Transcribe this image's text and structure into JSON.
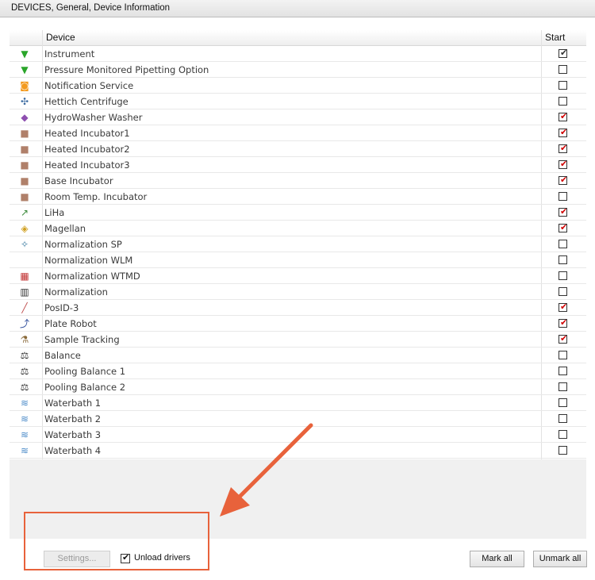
{
  "header": {
    "title": "DEVICES, General, Device Information"
  },
  "table": {
    "col_device": "Device",
    "col_start": "Start",
    "rows": [
      {
        "name": "Instrument",
        "icon": "green-triangle-icon",
        "glyph": "▼",
        "color": "#2aa52a",
        "checked": "gray"
      },
      {
        "name": "Pressure Monitored Pipetting Option",
        "icon": "green-triangle-icon",
        "glyph": "▼",
        "color": "#2aa52a",
        "checked": "off"
      },
      {
        "name": "Notification Service",
        "icon": "rss-icon",
        "glyph": "◙",
        "color": "#f39a1f",
        "checked": "off"
      },
      {
        "name": "Hettich Centrifuge",
        "icon": "centrifuge-icon",
        "glyph": "✣",
        "color": "#3a6aa0",
        "checked": "off"
      },
      {
        "name": "HydroWasher Washer",
        "icon": "washer-icon",
        "glyph": "◆",
        "color": "#8e4fb0",
        "checked": "on"
      },
      {
        "name": "Heated Incubator1",
        "icon": "incubator-icon",
        "glyph": "■",
        "color": "#b0806a",
        "checked": "on"
      },
      {
        "name": "Heated Incubator2",
        "icon": "incubator-icon",
        "glyph": "■",
        "color": "#b0806a",
        "checked": "on"
      },
      {
        "name": "Heated Incubator3",
        "icon": "incubator-icon",
        "glyph": "■",
        "color": "#b0806a",
        "checked": "on"
      },
      {
        "name": "Base Incubator",
        "icon": "incubator-icon",
        "glyph": "■",
        "color": "#b0806a",
        "checked": "on"
      },
      {
        "name": "Room Temp. Incubator",
        "icon": "incubator-icon",
        "glyph": "■",
        "color": "#b0806a",
        "checked": "off"
      },
      {
        "name": "LiHa",
        "icon": "liha-icon",
        "glyph": "↗",
        "color": "#3a8a3a",
        "checked": "on"
      },
      {
        "name": "Magellan",
        "icon": "magellan-icon",
        "glyph": "◈",
        "color": "#d0a020",
        "checked": "on"
      },
      {
        "name": "Normalization SP",
        "icon": "normalization-sp-icon",
        "glyph": "✧",
        "color": "#3a7aa0",
        "checked": "off"
      },
      {
        "name": "Normalization WLM",
        "icon": "",
        "glyph": "",
        "color": "#ffffff",
        "checked": "off"
      },
      {
        "name": "Normalization WTMD",
        "icon": "normalization-wtmd-icon",
        "glyph": "▦",
        "color": "#c03030",
        "checked": "off"
      },
      {
        "name": "Normalization",
        "icon": "normalization-icon",
        "glyph": "▥",
        "color": "#303030",
        "checked": "off"
      },
      {
        "name": "PosID-3",
        "icon": "posid-icon",
        "glyph": "╱",
        "color": "#c05050",
        "checked": "on"
      },
      {
        "name": "Plate Robot",
        "icon": "plate-robot-icon",
        "glyph": "⤴",
        "color": "#2a4a9a",
        "checked": "on"
      },
      {
        "name": "Sample Tracking",
        "icon": "sample-tracking-icon",
        "glyph": "⚗",
        "color": "#8a6a3a",
        "checked": "on"
      },
      {
        "name": "Balance",
        "icon": "balance-icon",
        "glyph": "⚖",
        "color": "#303030",
        "checked": "off"
      },
      {
        "name": "Pooling Balance 1",
        "icon": "balance-icon",
        "glyph": "⚖",
        "color": "#303030",
        "checked": "off"
      },
      {
        "name": "Pooling Balance 2",
        "icon": "balance-icon",
        "glyph": "⚖",
        "color": "#303030",
        "checked": "off"
      },
      {
        "name": "Waterbath 1",
        "icon": "waterbath-icon",
        "glyph": "≋",
        "color": "#4a8ac8",
        "checked": "off"
      },
      {
        "name": "Waterbath 2",
        "icon": "waterbath-icon",
        "glyph": "≋",
        "color": "#4a8ac8",
        "checked": "off"
      },
      {
        "name": "Waterbath 3",
        "icon": "waterbath-icon",
        "glyph": "≋",
        "color": "#4a8ac8",
        "checked": "off"
      },
      {
        "name": "Waterbath 4",
        "icon": "waterbath-icon",
        "glyph": "≋",
        "color": "#4a8ac8",
        "checked": "off"
      }
    ]
  },
  "footer": {
    "settings_label": "Settings...",
    "unload_label": "Unload drivers",
    "unload_checked": true,
    "mark_all_label": "Mark all",
    "unmark_all_label": "Unmark all"
  },
  "annotation_color": "#e8623b"
}
